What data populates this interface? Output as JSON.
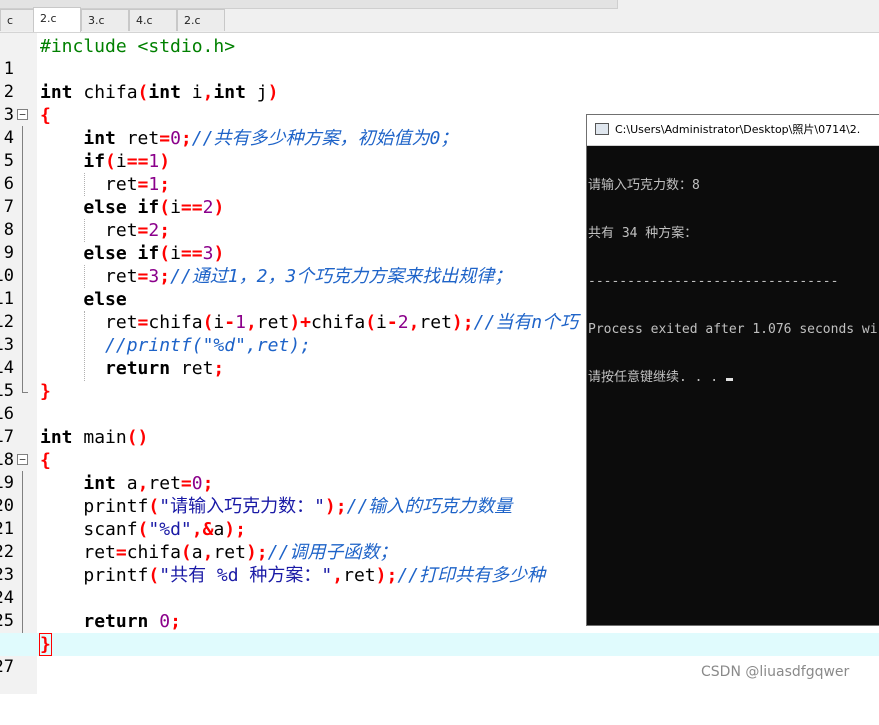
{
  "tabs": [
    {
      "label": "c",
      "active": false
    },
    {
      "label": "2.c",
      "active": true
    },
    {
      "label": "3.c",
      "active": false
    },
    {
      "label": "4.c",
      "active": false
    },
    {
      "label": "2.c",
      "active": false
    }
  ],
  "line_numbers": [
    "1",
    "2",
    "3",
    "4",
    "5",
    "6",
    "7",
    "8",
    "9",
    "10",
    "11",
    "12",
    "13",
    "14",
    "15",
    "16",
    "17",
    "18",
    "19",
    "20",
    "21",
    "22",
    "23",
    "24",
    "25",
    "26",
    "27"
  ],
  "code": {
    "l1": {
      "directive": "#include",
      "header": " <stdio.h>"
    },
    "l3": {
      "type": "int",
      "name": " chifa",
      "lp": "(",
      "p1t": "int",
      "p1": " i",
      "comma": ",",
      "p2t": "int",
      "p2": " j",
      "rp": ")"
    },
    "l4": {
      "brace": "{"
    },
    "l5": {
      "type": "int",
      "text": " ret",
      "eq": "=",
      "num": "0",
      "semi": ";",
      "comment": "//共有多少种方案，初始值为0；"
    },
    "l6": {
      "kw": "if",
      "lp": "(",
      "var": "i",
      "eq": "==",
      "num": "1",
      "rp": ")"
    },
    "l7": {
      "text": "ret",
      "eq": "=",
      "num": "1",
      "semi": ";"
    },
    "l8": {
      "kw1": "else",
      "kw2": " if",
      "lp": "(",
      "var": "i",
      "eq": "==",
      "num": "2",
      "rp": ")"
    },
    "l9": {
      "text": "ret",
      "eq": "=",
      "num": "2",
      "semi": ";"
    },
    "l10": {
      "kw1": "else",
      "kw2": " if",
      "lp": "(",
      "var": "i",
      "eq": "==",
      "num": "3",
      "rp": ")"
    },
    "l11": {
      "text": "ret",
      "eq": "=",
      "num": "3",
      "semi": ";",
      "comment": "//通过1，2，3个巧克力方案来找出规律；"
    },
    "l12": {
      "kw": "else"
    },
    "l13": {
      "a": "ret",
      "eq": "=",
      "b": "chifa",
      "lp": "(",
      "c": "i",
      "minus": "-",
      "n1": "1",
      "comma": ",",
      "d": "ret",
      "rp": ")",
      "plus": "+",
      "e": "chifa",
      "lp2": "(",
      "f": "i",
      "minus2": "-",
      "n2": "2",
      "comma2": ",",
      "g": "ret",
      "rp2": ")",
      "semi": ";",
      "comment": "//当有n个巧"
    },
    "l14": {
      "comment": "//printf(\"%d\",ret);"
    },
    "l15": {
      "kw": "return",
      "text": " ret",
      "semi": ";"
    },
    "l16": {
      "brace": "}"
    },
    "l18": {
      "type": "int",
      "name": " main",
      "parens": "()"
    },
    "l19": {
      "brace": "{"
    },
    "l20": {
      "type": "int",
      "a": " a",
      "comma": ",",
      "b": "ret",
      "eq": "=",
      "num": "0",
      "semi": ";"
    },
    "l21": {
      "fn": "printf",
      "lp": "(",
      "str": "\"请输入巧克力数：\"",
      "rp": ")",
      "semi": ";",
      "comment": "//输入的巧克力数量"
    },
    "l22": {
      "fn": "scanf",
      "lp": "(",
      "str": "\"%d\"",
      "comma": ",",
      "amp": "&",
      "var": "a",
      "rp": ")",
      "semi": ";"
    },
    "l23": {
      "a": "ret",
      "eq": "=",
      "fn": "chifa",
      "lp": "(",
      "b": "a",
      "comma": ",",
      "c": "ret",
      "rp": ")",
      "semi": ";",
      "comment": "//调用子函数；"
    },
    "l24": {
      "fn": "printf",
      "lp": "(",
      "str": "\"共有 %d 种方案：\"",
      "comma": ",",
      "var": "ret",
      "rp": ")",
      "semi": ";",
      "comment": "//打印共有多少种"
    },
    "l26": {
      "kw": "return",
      "num": " 0",
      "semi": ";"
    },
    "l27": {
      "brace": "}"
    }
  },
  "console": {
    "title": "C:\\Users\\Administrator\\Desktop\\照片\\0714\\2.",
    "lines": [
      "请输入巧克力数：8",
      "共有 34 种方案：",
      "--------------------------------",
      "Process exited after 1.076 seconds wi",
      "请按任意键继续. . . "
    ]
  },
  "watermark": "CSDN @liuasdfgqwer"
}
